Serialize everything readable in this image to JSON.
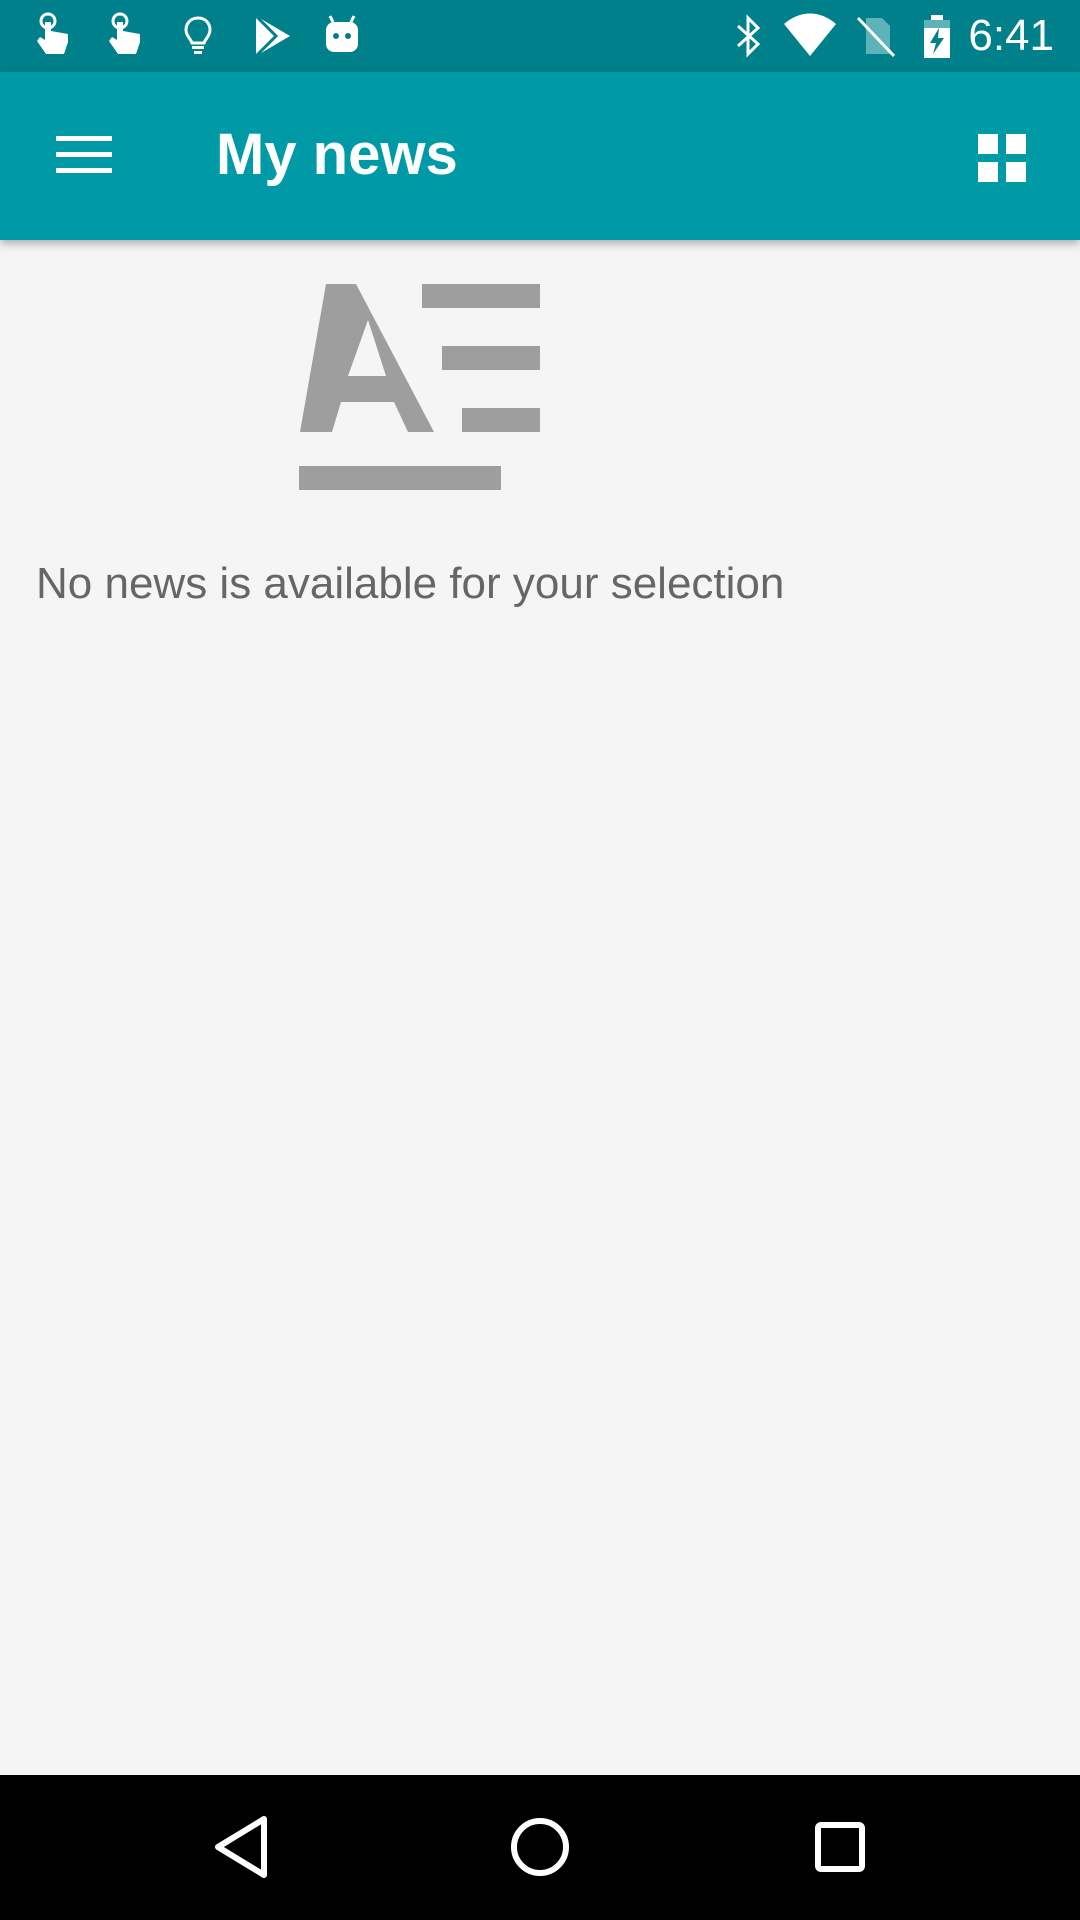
{
  "status_bar": {
    "time": "6:41",
    "notification_icons": [
      "touch-app-icon",
      "touch-app-icon",
      "lightbulb-icon",
      "play-store-icon",
      "android-robot-icon"
    ],
    "system_icons": [
      "bluetooth-icon",
      "wifi-icon",
      "no-sim-icon",
      "battery-charging-icon"
    ]
  },
  "app_bar": {
    "title": "My news",
    "menu_icon": "hamburger-menu-icon",
    "view_toggle_icon": "grid-view-icon"
  },
  "content": {
    "empty_icon": "news-article-icon",
    "empty_message": "No news is available for your selection"
  },
  "nav_bar": {
    "buttons": [
      "back-icon",
      "home-icon",
      "recents-icon"
    ]
  },
  "colors": {
    "status_bar": "#00808a",
    "app_bar": "#0099a6",
    "background": "#f5f5f5",
    "empty_icon": "#9e9e9e",
    "empty_text": "#666666",
    "nav_bar": "#000000"
  }
}
